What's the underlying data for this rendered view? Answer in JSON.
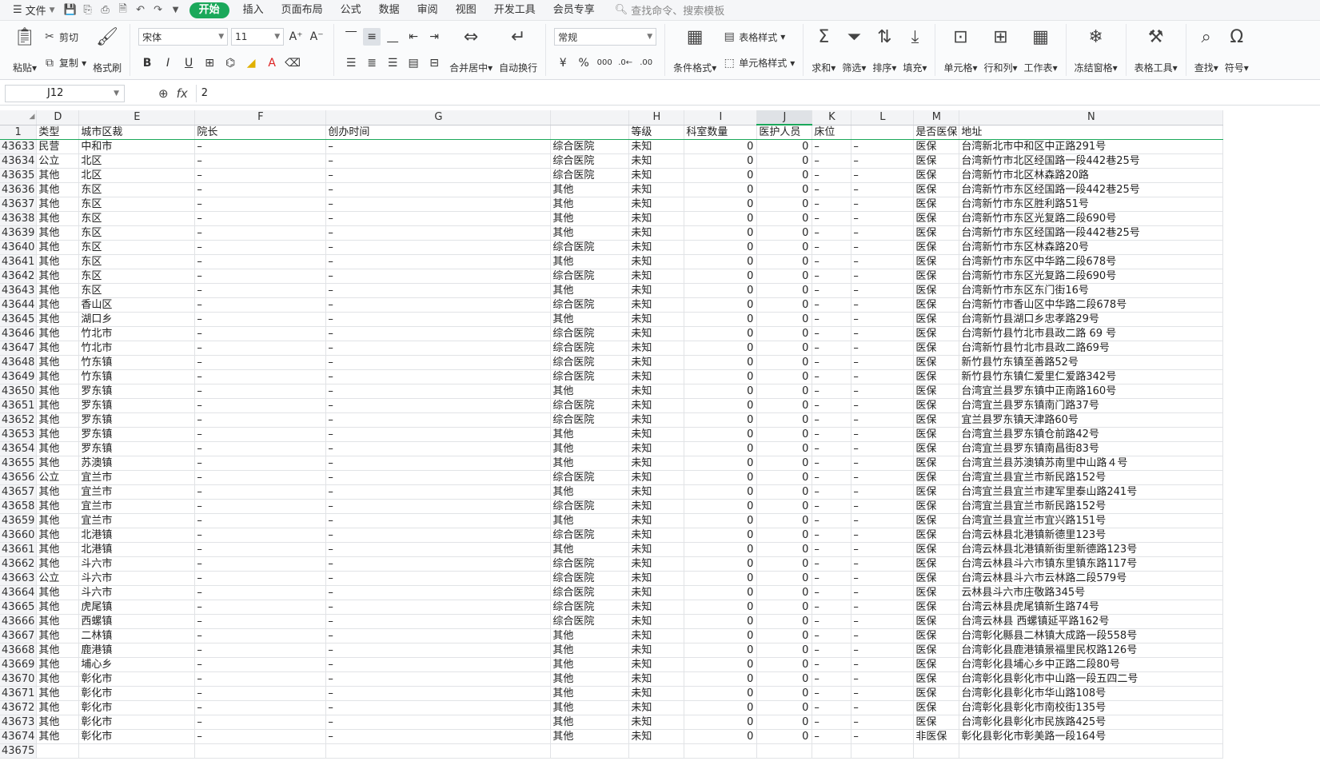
{
  "menubar": {
    "file_label": "文件",
    "tabs": [
      "开始",
      "插入",
      "页面布局",
      "公式",
      "数据",
      "审阅",
      "视图",
      "开发工具",
      "会员专享"
    ],
    "active_tab": "开始",
    "search_placeholder": "查找命令、搜索模板"
  },
  "ribbon": {
    "paste": "粘贴",
    "cut": "剪切",
    "copy": "复制",
    "format_painter": "格式刷",
    "font_name": "宋体",
    "font_size": "11",
    "merge_center": "合并居中",
    "wrap_text": "自动换行",
    "number_format": "常规",
    "conditional_format": "条件格式",
    "table_style": "表格样式",
    "cell_style": "单元格样式",
    "sum": "求和",
    "filter": "筛选",
    "sort": "排序",
    "fill": "填充",
    "cells": "单元格",
    "rows_cols": "行和列",
    "worksheet": "工作表",
    "freeze": "冻结窗格",
    "table_tools": "表格工具",
    "find": "查找",
    "symbol": "符号"
  },
  "formula_bar": {
    "cell_ref": "J12",
    "value": "2"
  },
  "grid": {
    "columns": [
      "D",
      "E",
      "F",
      "G",
      "H",
      "I",
      "J",
      "K",
      "L",
      "M",
      "N"
    ],
    "header_row_number": "1",
    "header": [
      "类型",
      "城市区裁",
      "院长",
      "创办时间",
      "",
      "等级",
      "科室数量",
      "医护人员",
      "床位",
      "",
      "是否医保",
      "地址"
    ],
    "rows": [
      [
        "43633",
        "民营",
        "中和市",
        "–",
        "–",
        "综合医院",
        "未知",
        "0",
        "0",
        "–",
        "–",
        "医保",
        "台湾新北市中和区中正路291号"
      ],
      [
        "43634",
        "公立",
        "北区",
        "–",
        "–",
        "综合医院",
        "未知",
        "0",
        "0",
        "–",
        "–",
        "医保",
        "台湾新竹市北区经国路一段442巷25号"
      ],
      [
        "43635",
        "其他",
        "北区",
        "–",
        "–",
        "综合医院",
        "未知",
        "0",
        "0",
        "–",
        "–",
        "医保",
        "台湾新竹市北区林森路20路"
      ],
      [
        "43636",
        "其他",
        "东区",
        "–",
        "–",
        "其他",
        "未知",
        "0",
        "0",
        "–",
        "–",
        "医保",
        "台湾新竹市东区经国路一段442巷25号"
      ],
      [
        "43637",
        "其他",
        "东区",
        "–",
        "–",
        "其他",
        "未知",
        "0",
        "0",
        "–",
        "–",
        "医保",
        "台湾新竹市东区胜利路51号"
      ],
      [
        "43638",
        "其他",
        "东区",
        "–",
        "–",
        "其他",
        "未知",
        "0",
        "0",
        "–",
        "–",
        "医保",
        "台湾新竹市东区光复路二段690号"
      ],
      [
        "43639",
        "其他",
        "东区",
        "–",
        "–",
        "其他",
        "未知",
        "0",
        "0",
        "–",
        "–",
        "医保",
        "台湾新竹市东区经国路一段442巷25号"
      ],
      [
        "43640",
        "其他",
        "东区",
        "–",
        "–",
        "综合医院",
        "未知",
        "0",
        "0",
        "–",
        "–",
        "医保",
        "台湾新竹市东区林森路20号"
      ],
      [
        "43641",
        "其他",
        "东区",
        "–",
        "–",
        "其他",
        "未知",
        "0",
        "0",
        "–",
        "–",
        "医保",
        "台湾新竹市东区中华路二段678号"
      ],
      [
        "43642",
        "其他",
        "东区",
        "–",
        "–",
        "综合医院",
        "未知",
        "0",
        "0",
        "–",
        "–",
        "医保",
        "台湾新竹市东区光复路二段690号"
      ],
      [
        "43643",
        "其他",
        "东区",
        "–",
        "–",
        "其他",
        "未知",
        "0",
        "0",
        "–",
        "–",
        "医保",
        "台湾新竹市东区东门街16号"
      ],
      [
        "43644",
        "其他",
        "香山区",
        "–",
        "–",
        "综合医院",
        "未知",
        "0",
        "0",
        "–",
        "–",
        "医保",
        "台湾新竹市香山区中华路二段678号"
      ],
      [
        "43645",
        "其他",
        "湖口乡",
        "–",
        "–",
        "其他",
        "未知",
        "0",
        "0",
        "–",
        "–",
        "医保",
        "台湾新竹县湖口乡忠孝路29号"
      ],
      [
        "43646",
        "其他",
        "竹北市",
        "–",
        "–",
        "综合医院",
        "未知",
        "0",
        "0",
        "–",
        "–",
        "医保",
        "台湾新竹县竹北市县政二路 69 号"
      ],
      [
        "43647",
        "其他",
        "竹北市",
        "–",
        "–",
        "综合医院",
        "未知",
        "0",
        "0",
        "–",
        "–",
        "医保",
        "台湾新竹县竹北市县政二路69号"
      ],
      [
        "43648",
        "其他",
        "竹东镇",
        "–",
        "–",
        "综合医院",
        "未知",
        "0",
        "0",
        "–",
        "–",
        "医保",
        "新竹县竹东镇至善路52号"
      ],
      [
        "43649",
        "其他",
        "竹东镇",
        "–",
        "–",
        "综合医院",
        "未知",
        "0",
        "0",
        "–",
        "–",
        "医保",
        "新竹县竹东镇仁爱里仁爱路342号"
      ],
      [
        "43650",
        "其他",
        "罗东镇",
        "–",
        "–",
        "其他",
        "未知",
        "0",
        "0",
        "–",
        "–",
        "医保",
        "台湾宜兰县罗东镇中正南路160号"
      ],
      [
        "43651",
        "其他",
        "罗东镇",
        "–",
        "–",
        "综合医院",
        "未知",
        "0",
        "0",
        "–",
        "–",
        "医保",
        "台湾宜兰县罗东镇南门路37号"
      ],
      [
        "43652",
        "其他",
        "罗东镇",
        "–",
        "–",
        "综合医院",
        "未知",
        "0",
        "0",
        "–",
        "–",
        "医保",
        "宜兰县罗东镇天津路60号"
      ],
      [
        "43653",
        "其他",
        "罗东镇",
        "–",
        "–",
        "其他",
        "未知",
        "0",
        "0",
        "–",
        "–",
        "医保",
        "台湾宜兰县罗东镇仓前路42号"
      ],
      [
        "43654",
        "其他",
        "罗东镇",
        "–",
        "–",
        "其他",
        "未知",
        "0",
        "0",
        "–",
        "–",
        "医保",
        "台湾宜兰县罗东镇南昌街83号"
      ],
      [
        "43655",
        "其他",
        "苏澳镇",
        "–",
        "–",
        "其他",
        "未知",
        "0",
        "0",
        "–",
        "–",
        "医保",
        "台湾宜兰县苏澳镇苏南里中山路４号"
      ],
      [
        "43656",
        "公立",
        "宜兰市",
        "–",
        "–",
        "综合医院",
        "未知",
        "0",
        "0",
        "–",
        "–",
        "医保",
        "台湾宜兰县宜兰市新民路152号"
      ],
      [
        "43657",
        "其他",
        "宜兰市",
        "–",
        "–",
        "其他",
        "未知",
        "0",
        "0",
        "–",
        "–",
        "医保",
        "台湾宜兰县宜兰市建军里泰山路241号"
      ],
      [
        "43658",
        "其他",
        "宜兰市",
        "–",
        "–",
        "综合医院",
        "未知",
        "0",
        "0",
        "–",
        "–",
        "医保",
        "台湾宜兰县宜兰市新民路152号"
      ],
      [
        "43659",
        "其他",
        "宜兰市",
        "–",
        "–",
        "其他",
        "未知",
        "0",
        "0",
        "–",
        "–",
        "医保",
        "台湾宜兰县宜兰市宜兴路151号"
      ],
      [
        "43660",
        "其他",
        "北港镇",
        "–",
        "–",
        "综合医院",
        "未知",
        "0",
        "0",
        "–",
        "–",
        "医保",
        "台湾云林县北港镇新德里123号"
      ],
      [
        "43661",
        "其他",
        "北港镇",
        "–",
        "–",
        "其他",
        "未知",
        "0",
        "0",
        "–",
        "–",
        "医保",
        "台湾云林县北港镇新街里新德路123号"
      ],
      [
        "43662",
        "其他",
        "斗六市",
        "–",
        "–",
        "综合医院",
        "未知",
        "0",
        "0",
        "–",
        "–",
        "医保",
        "台湾云林县斗六市镇东里镇东路117号"
      ],
      [
        "43663",
        "公立",
        "斗六市",
        "–",
        "–",
        "综合医院",
        "未知",
        "0",
        "0",
        "–",
        "–",
        "医保",
        "台湾云林县斗六市云林路二段579号"
      ],
      [
        "43664",
        "其他",
        "斗六市",
        "–",
        "–",
        "综合医院",
        "未知",
        "0",
        "0",
        "–",
        "–",
        "医保",
        "云林县斗六市庄敬路345号"
      ],
      [
        "43665",
        "其他",
        "虎尾镇",
        "–",
        "–",
        "综合医院",
        "未知",
        "0",
        "0",
        "–",
        "–",
        "医保",
        "台湾云林县虎尾镇新生路74号"
      ],
      [
        "43666",
        "其他",
        "西螺镇",
        "–",
        "–",
        "综合医院",
        "未知",
        "0",
        "0",
        "–",
        "–",
        "医保",
        "台湾云林县 西螺镇延平路162号"
      ],
      [
        "43667",
        "其他",
        "二林镇",
        "–",
        "–",
        "其他",
        "未知",
        "0",
        "0",
        "–",
        "–",
        "医保",
        "台湾彰化縣县二林镇大成路一段558号"
      ],
      [
        "43668",
        "其他",
        "鹿港镇",
        "–",
        "–",
        "其他",
        "未知",
        "0",
        "0",
        "–",
        "–",
        "医保",
        "台湾彰化县鹿港镇景福里民权路126号"
      ],
      [
        "43669",
        "其他",
        "埔心乡",
        "–",
        "–",
        "其他",
        "未知",
        "0",
        "0",
        "–",
        "–",
        "医保",
        "台湾彰化县埔心乡中正路二段80号"
      ],
      [
        "43670",
        "其他",
        "彰化市",
        "–",
        "–",
        "其他",
        "未知",
        "0",
        "0",
        "–",
        "–",
        "医保",
        "台湾彰化县彰化市中山路一段五四二号"
      ],
      [
        "43671",
        "其他",
        "彰化市",
        "–",
        "–",
        "其他",
        "未知",
        "0",
        "0",
        "–",
        "–",
        "医保",
        "台湾彰化县彰化市华山路108号"
      ],
      [
        "43672",
        "其他",
        "彰化市",
        "–",
        "–",
        "其他",
        "未知",
        "0",
        "0",
        "–",
        "–",
        "医保",
        "台湾彰化县彰化市南校街135号"
      ],
      [
        "43673",
        "其他",
        "彰化市",
        "–",
        "–",
        "其他",
        "未知",
        "0",
        "0",
        "–",
        "–",
        "医保",
        "台湾彰化县彰化市民族路425号"
      ],
      [
        "43674",
        "其他",
        "彰化市",
        "–",
        "–",
        "其他",
        "未知",
        "0",
        "0",
        "–",
        "–",
        "非医保",
        "彰化县彰化市彰美路一段164号"
      ],
      [
        "43675",
        "",
        "",
        "",
        "",
        "",
        "",
        "",
        "",
        "",
        "",
        "",
        ""
      ]
    ]
  },
  "colors": {
    "accent": "#1aa85a"
  }
}
